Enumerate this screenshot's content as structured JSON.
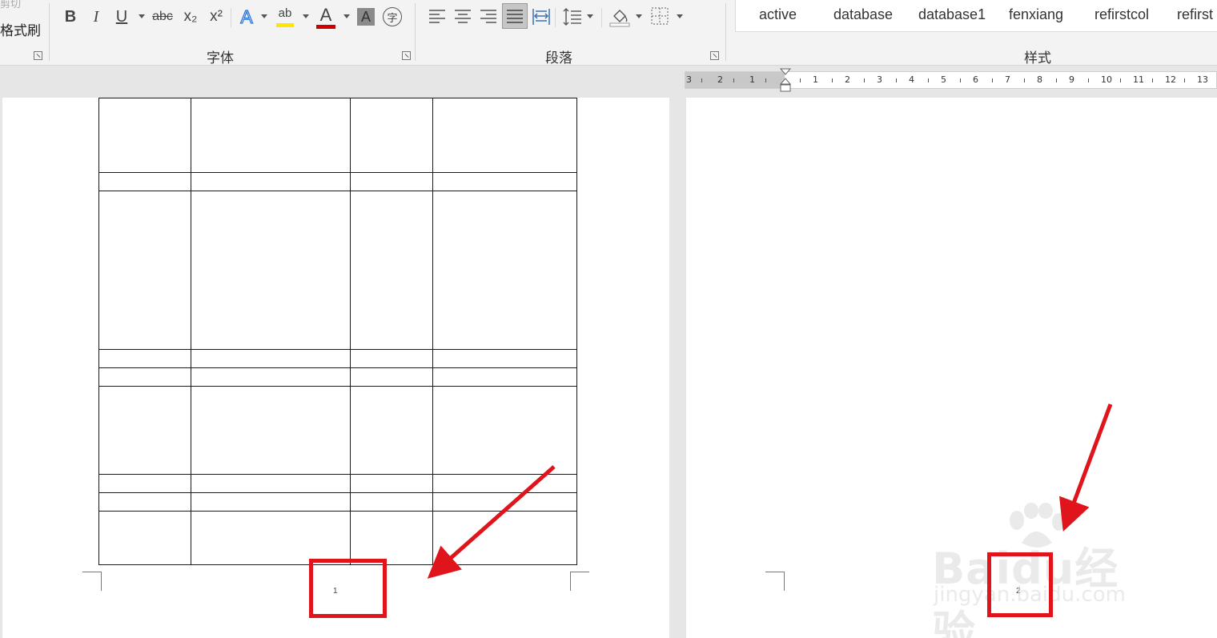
{
  "ribbon": {
    "clipboard": {
      "top_partial": "剪切",
      "format_painter": "格式刷"
    },
    "font_group": {
      "label": "字体",
      "bold": "B",
      "italic": "I",
      "underline": "U",
      "strike": "abc",
      "subscript": "x₂",
      "superscript": "x²",
      "text_effect": "A",
      "highlight": "ab",
      "font_color": "A",
      "char_shading": "A",
      "enclose_char": "字"
    },
    "paragraph_group": {
      "label": "段落"
    },
    "styles_group": {
      "label": "样式",
      "items": [
        "active",
        "database",
        "database1",
        "fenxiang",
        "refirstcol",
        "refirst"
      ]
    }
  },
  "ruler": {
    "left_numbers": [
      "3",
      "2",
      "1"
    ],
    "right_numbers": [
      "1",
      "2",
      "3",
      "4",
      "5",
      "6",
      "7",
      "8",
      "9",
      "10",
      "11",
      "12",
      "13"
    ]
  },
  "pages": {
    "left": {
      "page_number": "1"
    },
    "right": {
      "page_number": "2"
    }
  },
  "watermark": {
    "brand": "Baidu经验",
    "url": "jingyan.baidu.com"
  },
  "colors": {
    "annotation_red": "#e0141b",
    "highlight_yellow": "#ffe600",
    "font_red": "#d00000",
    "text_effect_blue": "#2e75d6"
  }
}
